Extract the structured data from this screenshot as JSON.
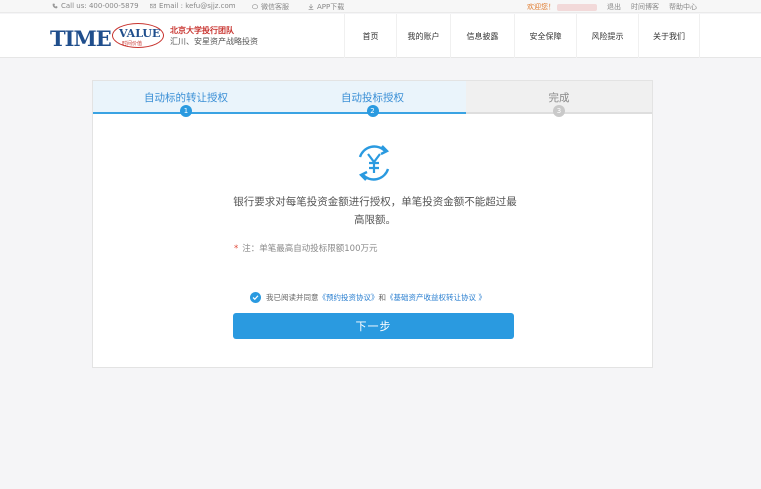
{
  "topbar": {
    "phone": "Call us: 400-000-5879",
    "email": "Email : kefu@sjjz.com",
    "wechat": "微信客服",
    "app": "APP下载",
    "welcome": "欢迎您！",
    "logout": "退出",
    "blog": "时间博客",
    "help": "帮助中心"
  },
  "brand": {
    "logo_time": "TIME",
    "logo_value": "VALUE",
    "logo_sub": "时间价值",
    "tagline_line1": "北京大学投行团队",
    "tagline_line2": "汇川、安星资产战略投资"
  },
  "nav": {
    "items": [
      "首页",
      "我的账户",
      "信息披露",
      "安全保障",
      "风险提示",
      "关于我们"
    ]
  },
  "steps": [
    {
      "label": "自动标的转让授权",
      "number": "1",
      "state": "active"
    },
    {
      "label": "自动投标授权",
      "number": "2",
      "state": "active"
    },
    {
      "label": "完成",
      "number": "3",
      "state": "pending"
    }
  ],
  "content": {
    "message": "银行要求对每笔投资金额进行授权，单笔投资金额不能超过最高限额。",
    "note_star": "*",
    "note": "注：单笔最高自动投标限额100万元",
    "agree_prefix": "我已阅读并同意",
    "agree_link1": "《预约投资协议》",
    "agree_and": "和",
    "agree_link2": "《基础资产收益权转让协议 》",
    "next_button": "下一步"
  },
  "colors": {
    "accent": "#2a9ae0",
    "brand_red": "#c8342f",
    "brand_blue": "#1f4e8c",
    "welcome": "#e07b2e"
  }
}
